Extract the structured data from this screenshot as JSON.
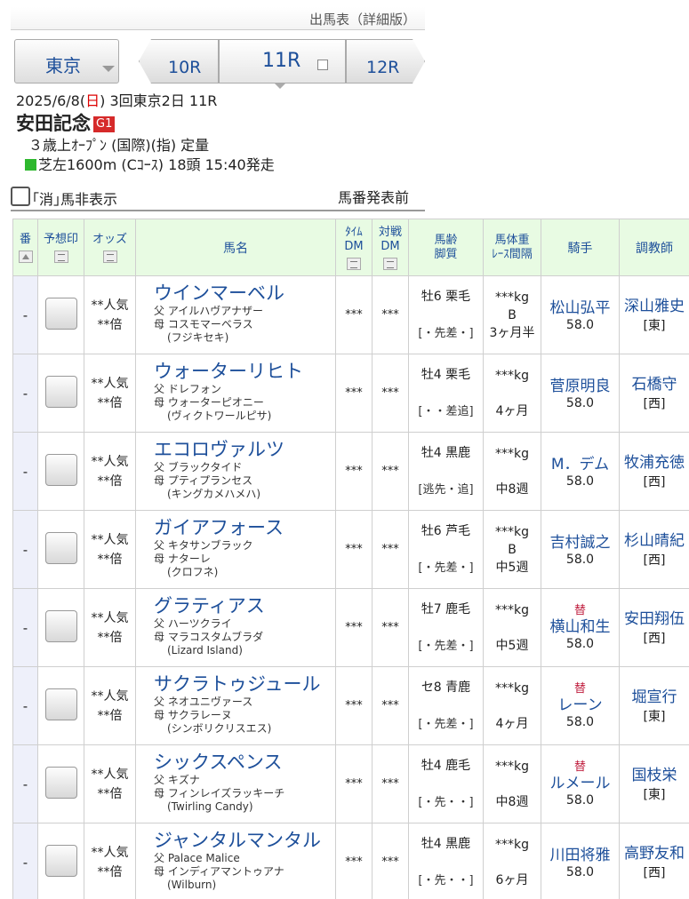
{
  "page_header": "出馬表（詳細版）",
  "nav": {
    "venue": "東京",
    "prev_race": "10R",
    "current_race": "11R",
    "next_race": "12R"
  },
  "race": {
    "date_prefix": "2025/6/8(",
    "date_day": "日",
    "date_suffix": ") 3回東京2日 11R",
    "name": "安田記念",
    "grade": "G1",
    "conditions": "３歳上ｵｰﾌﾟﾝ (国際)(指) 定量",
    "course": "芝左1600m (Cｺｰｽ) 18頭 15:40発走"
  },
  "controls": {
    "hide_scratched_label": "｢消｣馬非表示",
    "status_text": "馬番発表前"
  },
  "table": {
    "headers": {
      "num": "番",
      "mark": "予想印",
      "odds": "オッズ",
      "horse": "馬名",
      "time_dm_top": "ﾀｲﾑ",
      "time_dm_bottom": "DM",
      "match_dm_top": "対戦",
      "match_dm_bottom": "DM",
      "age_top": "馬齢",
      "age_bottom": "脚質",
      "weight_top": "馬体重",
      "weight_bottom": "ﾚｰｽ間隔",
      "jockey": "騎手",
      "trainer": "調教師"
    },
    "rows": [
      {
        "num": "-",
        "pop": "**人気",
        "odds": "**倍",
        "horse": "ウインマーベル",
        "sire": "父 アイルハヴアナザー",
        "dam": "母 コスモマーベラス",
        "damsire": "(フジキセキ)",
        "time_dm": "***",
        "match_dm": "***",
        "age": "牡6 栗毛",
        "style": "[・先差・]",
        "weight": "***kg",
        "blinker": "B",
        "interval": "3ヶ月半",
        "swap": "",
        "jockey": "松山弘平",
        "kg": "58.0",
        "trainer": "深山雅史",
        "region": "[東]"
      },
      {
        "num": "-",
        "pop": "**人気",
        "odds": "**倍",
        "horse": "ウォーターリヒト",
        "sire": "父 ドレフォン",
        "dam": "母 ウォーターピオニー",
        "damsire": "(ヴィクトワールピサ)",
        "time_dm": "***",
        "match_dm": "***",
        "age": "牡4 栗毛",
        "style": "[・・差追]",
        "weight": "***kg",
        "blinker": "",
        "interval": "4ヶ月",
        "swap": "",
        "jockey": "菅原明良",
        "kg": "58.0",
        "trainer": "石橋守",
        "region": "[西]"
      },
      {
        "num": "-",
        "pop": "**人気",
        "odds": "**倍",
        "horse": "エコロヴァルツ",
        "sire": "父 ブラックタイド",
        "dam": "母 プティプランセス",
        "damsire": "(キングカメハメハ)",
        "time_dm": "***",
        "match_dm": "***",
        "age": "牡4 黒鹿",
        "style": "[逃先・追]",
        "weight": "***kg",
        "blinker": "",
        "interval": "中8週",
        "swap": "",
        "jockey": "M．デム",
        "kg": "58.0",
        "trainer": "牧浦充徳",
        "region": "[西]"
      },
      {
        "num": "-",
        "pop": "**人気",
        "odds": "**倍",
        "horse": "ガイアフォース",
        "sire": "父 キタサンブラック",
        "dam": "母 ナターレ",
        "damsire": "(クロフネ)",
        "time_dm": "***",
        "match_dm": "***",
        "age": "牡6 芦毛",
        "style": "[・先差・]",
        "weight": "***kg",
        "blinker": "B",
        "interval": "中5週",
        "swap": "",
        "jockey": "吉村誠之",
        "kg": "58.0",
        "trainer": "杉山晴紀",
        "region": "[西]"
      },
      {
        "num": "-",
        "pop": "**人気",
        "odds": "**倍",
        "horse": "グラティアス",
        "sire": "父 ハーツクライ",
        "dam": "母 マラコスタムブラダ",
        "damsire": "(Lizard Island)",
        "time_dm": "***",
        "match_dm": "***",
        "age": "牡7 鹿毛",
        "style": "[・先差・]",
        "weight": "***kg",
        "blinker": "",
        "interval": "中5週",
        "swap": "替",
        "jockey": "横山和生",
        "kg": "58.0",
        "trainer": "安田翔伍",
        "region": "[西]"
      },
      {
        "num": "-",
        "pop": "**人気",
        "odds": "**倍",
        "horse": "サクラトゥジュール",
        "sire": "父 ネオユニヴァース",
        "dam": "母 サクラレーヌ",
        "damsire": "(シンボリクリスエス)",
        "time_dm": "***",
        "match_dm": "***",
        "age": "セ8 青鹿",
        "style": "[・先差・]",
        "weight": "***kg",
        "blinker": "",
        "interval": "4ヶ月",
        "swap": "替",
        "jockey": "レーン",
        "kg": "58.0",
        "trainer": "堀宣行",
        "region": "[東]"
      },
      {
        "num": "-",
        "pop": "**人気",
        "odds": "**倍",
        "horse": "シックスペンス",
        "sire": "父 キズナ",
        "dam": "母 フィンレイズラッキーチ",
        "damsire": "(Twirling Candy)",
        "time_dm": "***",
        "match_dm": "***",
        "age": "牡4 鹿毛",
        "style": "[・先・・]",
        "weight": "***kg",
        "blinker": "",
        "interval": "中8週",
        "swap": "替",
        "jockey": "ルメール",
        "kg": "58.0",
        "trainer": "国枝栄",
        "region": "[東]"
      },
      {
        "num": "-",
        "pop": "**人気",
        "odds": "**倍",
        "horse": "ジャンタルマンタル",
        "sire": "父 Palace Malice",
        "dam": "母 インディアマントゥアナ",
        "damsire": "(Wilburn)",
        "time_dm": "***",
        "match_dm": "***",
        "age": "牡4 黒鹿",
        "style": "[・先・・]",
        "weight": "***kg",
        "blinker": "",
        "interval": "6ヶ月",
        "swap": "",
        "jockey": "川田将雅",
        "kg": "58.0",
        "trainer": "高野友和",
        "region": "[西]"
      }
    ]
  }
}
